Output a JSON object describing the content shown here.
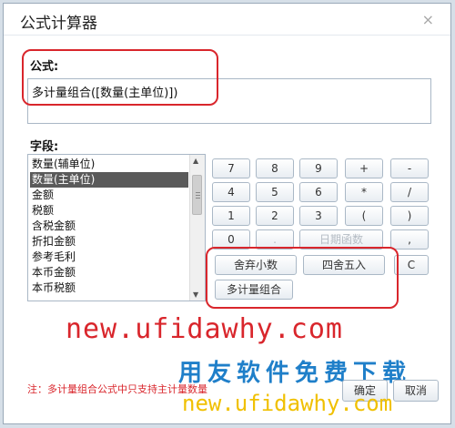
{
  "dialog": {
    "title": "公式计算器",
    "close_symbol": "×"
  },
  "formula": {
    "label": "公式:",
    "value": "多计量组合([数量(主单位)])"
  },
  "fields": {
    "label": "字段:",
    "items": [
      "数量(辅单位)",
      "数量(主单位)",
      "金额",
      "税额",
      "含税金额",
      "折扣金额",
      "参考毛利",
      "本币金额",
      "本币税额"
    ],
    "selected_index": 1
  },
  "keypad": {
    "row1": [
      "7",
      "8",
      "9",
      "+",
      "-"
    ],
    "row2": [
      "4",
      "5",
      "6",
      "*",
      "/"
    ],
    "row3": [
      "1",
      "2",
      "3",
      "(",
      ")"
    ],
    "row4": [
      "0",
      ".",
      "日期函数",
      ","
    ],
    "functions": [
      "舍弃小数",
      "四舍五入",
      "C"
    ],
    "combo": "多计量组合"
  },
  "note": "注：多计量组合公式中只支持主计量数量",
  "footer": {
    "ok_label": "确定",
    "cancel_label": "取消"
  },
  "watermark": {
    "line1": "new.ufidawhy.com",
    "line2": "用友软件免费下载",
    "line3": "new.ufidawhy.com"
  },
  "colors": {
    "highlight": "#d9262c",
    "watermark_blue": "#1f7fc9",
    "watermark_yellow": "#f0c000",
    "selected_item": "#5a5a5a"
  }
}
